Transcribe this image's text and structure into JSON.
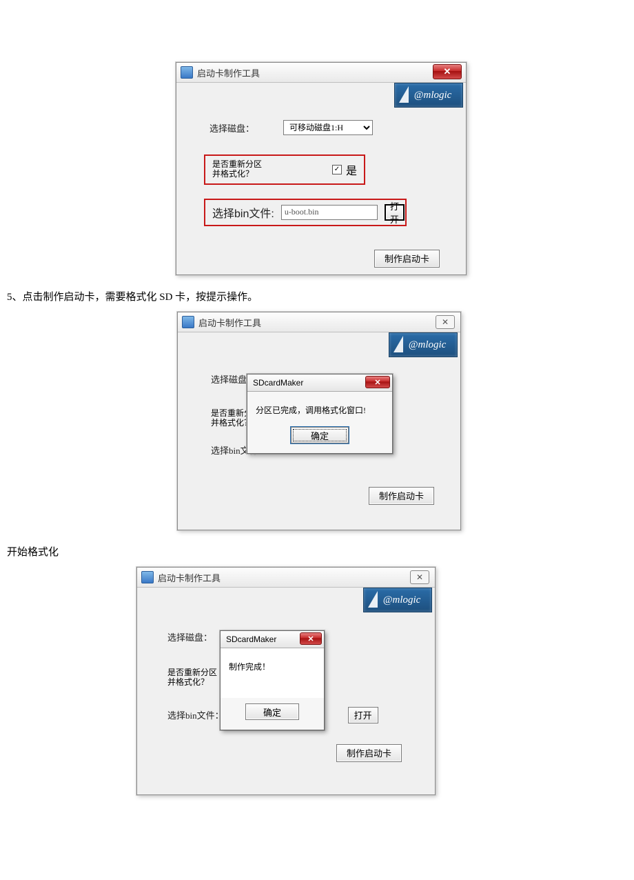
{
  "logo_text": "@mlogic",
  "doc": {
    "step5": "5、点击制作启动卡，需要格式化 SD 卡，按提示操作。",
    "start_format": "开始格式化"
  },
  "win1": {
    "title": "启动卡制作工具",
    "select_disk_label": "选择磁盘：",
    "select_disk_value": "可移动磁盘1:H",
    "repartition_line1": "是否重新分区",
    "repartition_line2": "并格式化？",
    "checkbox_yes": "是",
    "checkbox_checked": "✓",
    "select_bin_label": "选择bin文件:",
    "bin_value": "u-boot.bin",
    "open_btn": "打开",
    "make_btn": "制作启动卡"
  },
  "win2": {
    "title": "启动卡制作工具",
    "select_disk_label": "选择磁盘：",
    "repartition_line1": "是否重新分区",
    "repartition_line2": "并格式化？",
    "select_bin_label": "选择bin文件",
    "make_btn": "制作启动卡",
    "modal_title": "SDcardMaker",
    "modal_msg": "分区已完成，调用格式化窗口!",
    "modal_ok": "确定"
  },
  "win3": {
    "title": "启动卡制作工具",
    "select_disk_label": "选择磁盘：",
    "repartition_line1": "是否重新分区",
    "repartition_line2": "并格式化？",
    "select_bin_label": "选择bin文件：",
    "open_btn": "打开",
    "make_btn": "制作启动卡",
    "modal_title": "SDcardMaker",
    "modal_msg": "制作完成！",
    "modal_ok": "确定"
  }
}
